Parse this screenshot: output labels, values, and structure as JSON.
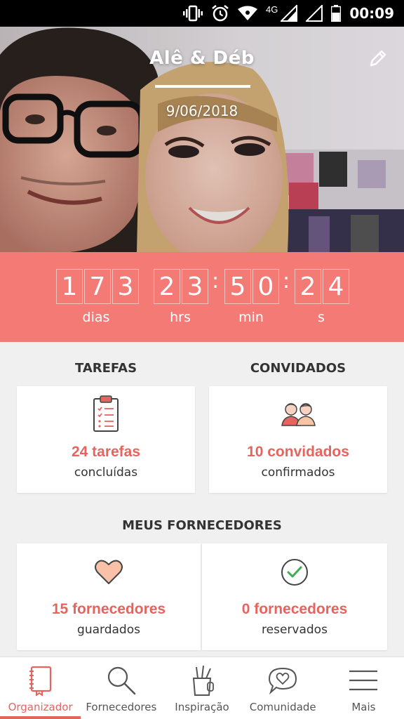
{
  "status_bar": {
    "time": "00:09",
    "network": "4G",
    "icons": [
      "vibrate-icon",
      "alarm-icon",
      "wifi-icon",
      "signal-icon",
      "battery-icon"
    ]
  },
  "hero": {
    "couple_names": "Alê & Déb",
    "date": "9/06/2018"
  },
  "countdown": {
    "days": [
      "1",
      "7",
      "3"
    ],
    "hours": [
      "2",
      "3"
    ],
    "minutes": [
      "5",
      "0"
    ],
    "seconds": [
      "2",
      "4"
    ],
    "labels": {
      "days": "dias",
      "hours": "hrs",
      "minutes": "min",
      "seconds": "s"
    },
    "background": "#f47a76"
  },
  "tasks": {
    "title": "TAREFAS",
    "count": "24 tarefas",
    "subtitle": "concluídas"
  },
  "guests": {
    "title": "CONVIDADOS",
    "count": "10 convidados",
    "subtitle": "confirmados"
  },
  "vendors": {
    "title": "MEUS FORNECEDORES",
    "saved": {
      "count": "15 fornecedores",
      "subtitle": "guardados"
    },
    "booked": {
      "count": "0 fornecedores",
      "subtitle": "reservados"
    }
  },
  "bottom_nav": {
    "items": [
      {
        "label": "Organizador",
        "icon": "notebook-icon",
        "active": true
      },
      {
        "label": "Fornecedores",
        "icon": "search-icon",
        "active": false
      },
      {
        "label": "Inspiração",
        "icon": "pencil-cup-icon",
        "active": false
      },
      {
        "label": "Comunidade",
        "icon": "chat-heart-icon",
        "active": false
      },
      {
        "label": "Mais",
        "icon": "menu-icon",
        "active": false
      }
    ]
  },
  "colors": {
    "accent": "#e5645f",
    "countdown_bg": "#f47a76",
    "page_bg": "#f0f0f0"
  }
}
